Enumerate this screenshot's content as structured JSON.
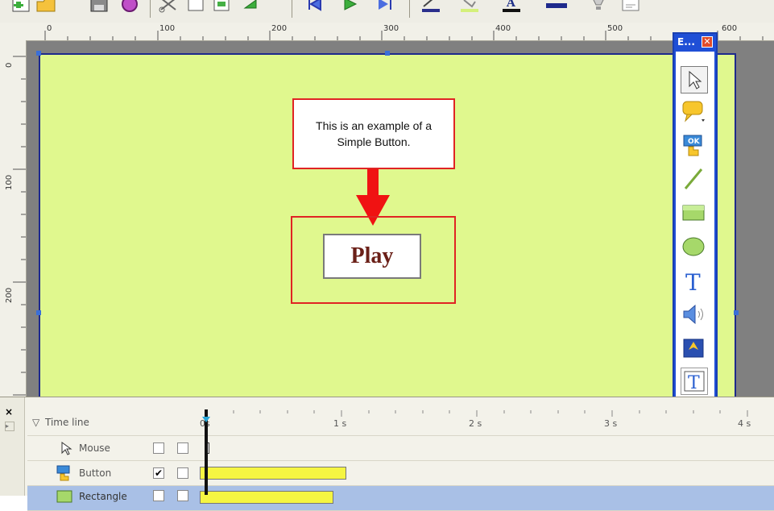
{
  "toolbar": {
    "icons": [
      "add-slide-icon",
      "open-folder-icon",
      "save-icon",
      "record-icon",
      "cut-icon",
      "copy-icon",
      "paste-icon",
      "redo-icon",
      "first-frame-icon",
      "play-icon",
      "next-frame-icon",
      "underline-color-icon",
      "fill-icon",
      "text-color-icon",
      "line-width-icon",
      "publish-icon",
      "properties-icon"
    ]
  },
  "ruler": {
    "h_labels": [
      "0",
      "100",
      "200",
      "300",
      "400",
      "500",
      "600"
    ],
    "v_labels": [
      "0",
      "100",
      "200"
    ]
  },
  "stage": {
    "callout_text": "This is an example of a Simple Button.",
    "button_label": "Play",
    "background": "#e0f88e"
  },
  "palette": {
    "title": "E...",
    "close": "✕",
    "tools": [
      "select-tool-icon",
      "caption-tool-icon",
      "button-tool-icon",
      "line-tool-icon",
      "rectangle-tool-icon",
      "ellipse-tool-icon",
      "text-tool-icon",
      "audio-tool-icon",
      "image-tool-icon",
      "text-animation-tool-icon"
    ]
  },
  "timeline": {
    "header": "Time line",
    "time_marks": [
      "0s",
      "1 s",
      "2 s",
      "3 s",
      "4 s"
    ],
    "rows": [
      {
        "label": "Mouse",
        "visible": false
      },
      {
        "label": "Button",
        "visible": true
      },
      {
        "label": "Rectangle",
        "visible": false
      }
    ],
    "close": "×",
    "expand": "▸"
  },
  "colors": {
    "accent": "#1f4fd6",
    "callout_border": "#e02424",
    "arrow": "#f01212",
    "bar": "#f5f542"
  }
}
